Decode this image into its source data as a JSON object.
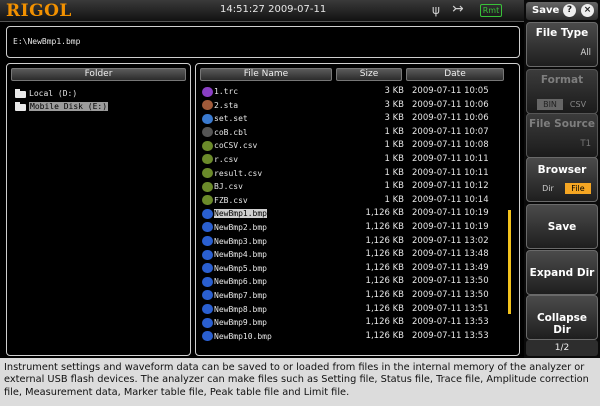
{
  "header": {
    "brand": "RIGOL",
    "clock": "14:51:27 2009-07-11",
    "rmt_badge": "Rmt",
    "icons": [
      "usb-probe-icon",
      "usb-device-icon"
    ]
  },
  "path": "E:\\NewBmp1.bmp",
  "folder_panel": {
    "header": "Folder",
    "items": [
      {
        "label": "Local (D:)",
        "selected": false
      },
      {
        "label": "Mobile Disk (E:)",
        "selected": true
      }
    ]
  },
  "file_panel": {
    "col_name": "File Name",
    "col_size": "Size",
    "col_date": "Date",
    "rows": [
      {
        "name": "1.trc",
        "size": "3 KB",
        "date": "2009-07-11 10:05",
        "icon": "trc",
        "color": "#8a3fc4"
      },
      {
        "name": "2.sta",
        "size": "3 KB",
        "date": "2009-07-11 10:06",
        "icon": "sta",
        "color": "#a05a3a"
      },
      {
        "name": "set.set",
        "size": "3 KB",
        "date": "2009-07-11 10:06",
        "icon": "set",
        "color": "#3a7ad0"
      },
      {
        "name": "coB.cbl",
        "size": "1 KB",
        "date": "2009-07-11 10:07",
        "icon": "cbl",
        "color": "#555"
      },
      {
        "name": "coCSV.csv",
        "size": "1 KB",
        "date": "2009-07-11 10:08",
        "icon": "csv",
        "color": "#6b8a2a"
      },
      {
        "name": "r.csv",
        "size": "1 KB",
        "date": "2009-07-11 10:11",
        "icon": "csv",
        "color": "#6b8a2a"
      },
      {
        "name": "result.csv",
        "size": "1 KB",
        "date": "2009-07-11 10:11",
        "icon": "csv",
        "color": "#6b8a2a"
      },
      {
        "name": "BJ.csv",
        "size": "1 KB",
        "date": "2009-07-11 10:12",
        "icon": "csv",
        "color": "#6b8a2a"
      },
      {
        "name": "FZB.csv",
        "size": "1 KB",
        "date": "2009-07-11 10:14",
        "icon": "csv",
        "color": "#6b8a2a"
      },
      {
        "name": "NewBmp1.bmp",
        "size": "1,126 KB",
        "date": "2009-07-11 10:19",
        "icon": "bmp",
        "color": "#2a5fd0",
        "selected": true
      },
      {
        "name": "NewBmp2.bmp",
        "size": "1,126 KB",
        "date": "2009-07-11 10:19",
        "icon": "bmp",
        "color": "#2a5fd0"
      },
      {
        "name": "NewBmp3.bmp",
        "size": "1,126 KB",
        "date": "2009-07-11 13:02",
        "icon": "bmp",
        "color": "#2a5fd0"
      },
      {
        "name": "NewBmp4.bmp",
        "size": "1,126 KB",
        "date": "2009-07-11 13:48",
        "icon": "bmp",
        "color": "#2a5fd0"
      },
      {
        "name": "NewBmp5.bmp",
        "size": "1,126 KB",
        "date": "2009-07-11 13:49",
        "icon": "bmp",
        "color": "#2a5fd0"
      },
      {
        "name": "NewBmp6.bmp",
        "size": "1,126 KB",
        "date": "2009-07-11 13:50",
        "icon": "bmp",
        "color": "#2a5fd0"
      },
      {
        "name": "NewBmp7.bmp",
        "size": "1,126 KB",
        "date": "2009-07-11 13:50",
        "icon": "bmp",
        "color": "#2a5fd0"
      },
      {
        "name": "NewBmp8.bmp",
        "size": "1,126 KB",
        "date": "2009-07-11 13:51",
        "icon": "bmp",
        "color": "#2a5fd0"
      },
      {
        "name": "NewBmp9.bmp",
        "size": "1,126 KB",
        "date": "2009-07-11 13:53",
        "icon": "bmp",
        "color": "#2a5fd0"
      },
      {
        "name": "NewBmp10.bmp",
        "size": "1,126 KB",
        "date": "2009-07-11 13:53",
        "icon": "bmp",
        "color": "#2a5fd0"
      }
    ]
  },
  "softmenu": {
    "title": "Save",
    "file_type": {
      "title": "File Type",
      "value": "All"
    },
    "format": {
      "title": "Format",
      "opt1": "BIN",
      "opt2": "CSV"
    },
    "file_source": {
      "title": "File Source",
      "value": "T1"
    },
    "browser": {
      "title": "Browser",
      "opt1": "Dir",
      "opt2": "File"
    },
    "save": "Save",
    "expand": "Expand Dir",
    "collapse": "Collapse Dir",
    "page": "1/2"
  },
  "description": "Instrument settings and waveform data can be saved to or loaded from files in the internal memory of the analyzer or external USB flash devices. The analyzer can make files such as Setting file, Status file, Trace file, Amplitude correction file, Measurement data, Marker table file, Peak table file and Limit file.",
  "colors": {
    "accent": "#f5a623",
    "brand": "#f29100",
    "scrollbar": "#f2c21c"
  }
}
